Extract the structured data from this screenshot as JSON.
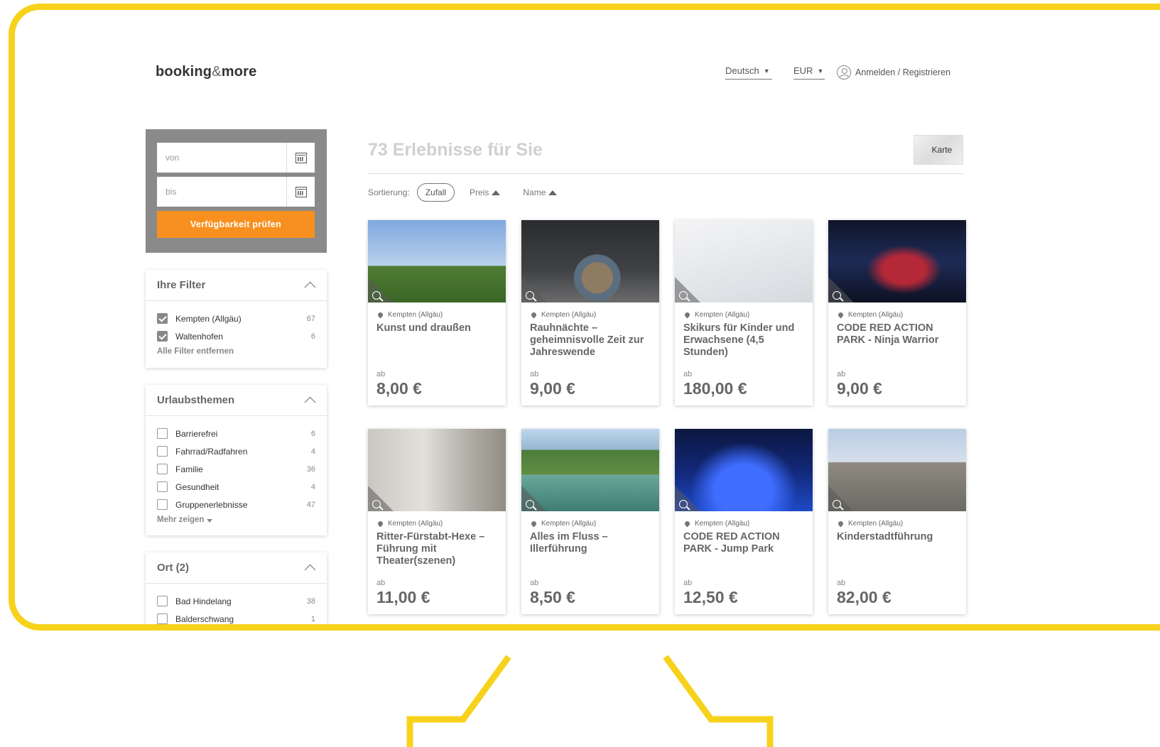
{
  "header": {
    "logo_main": "booking",
    "logo_amp": "&",
    "logo_end": "more",
    "language": "Deutsch",
    "currency": "EUR",
    "login": "Anmelden / Registrieren"
  },
  "availability": {
    "from_placeholder": "von",
    "to_placeholder": "bis",
    "check_button": "Verfügbarkeit prüfen"
  },
  "filters": {
    "active": {
      "title": "Ihre Filter",
      "items": [
        {
          "label": "Kempten (Allgäu)",
          "count": "67",
          "checked": true
        },
        {
          "label": "Waltenhofen",
          "count": "6",
          "checked": true
        }
      ],
      "remove_all": "Alle Filter entfernen"
    },
    "themes": {
      "title": "Urlaubsthemen",
      "items": [
        {
          "label": "Barrierefrei",
          "count": "6",
          "checked": false
        },
        {
          "label": "Fahrrad/Radfahren",
          "count": "4",
          "checked": false
        },
        {
          "label": "Familie",
          "count": "36",
          "checked": false
        },
        {
          "label": "Gesundheit",
          "count": "4",
          "checked": false
        },
        {
          "label": "Gruppenerlebnisse",
          "count": "47",
          "checked": false
        }
      ],
      "more": "Mehr zeigen"
    },
    "place": {
      "title": "Ort (2)",
      "items": [
        {
          "label": "Bad Hindelang",
          "count": "38",
          "checked": false
        },
        {
          "label": "Balderschwang",
          "count": "1",
          "checked": false
        }
      ]
    }
  },
  "results": {
    "title": "73 Erlebnisse für Sie",
    "map_button": "Karte",
    "sort_label": "Sortierung:",
    "sort_options": [
      "Zufall",
      "Preis",
      "Name"
    ],
    "active_sort": "Zufall",
    "price_prefix": "ab",
    "cards": [
      {
        "location": "Kempten (Allgäu)",
        "title": "Kunst und draußen",
        "price": "8,00 €",
        "image": "art-sky"
      },
      {
        "location": "Kempten (Allgäu)",
        "title": "Rauhnächte – geheimnisvolle Zeit zur Jahreswende",
        "price": "9,00 €",
        "image": "art-smoke"
      },
      {
        "location": "Kempten (Allgäu)",
        "title": "Skikurs für Kinder und Erwachsene (4,5 Stunden)",
        "price": "180,00 €",
        "image": "art-ski"
      },
      {
        "location": "Kempten (Allgäu)",
        "title": "CODE RED ACTION PARK - Ninja Warrior",
        "price": "9,00 €",
        "image": "art-red"
      },
      {
        "location": "Kempten (Allgäu)",
        "title": "Ritter-Fürstabt-Hexe – Führung mit Theater(szenen)",
        "price": "11,00 €",
        "image": "art-street"
      },
      {
        "location": "Kempten (Allgäu)",
        "title": "Alles im Fluss – Illerführung",
        "price": "8,50 €",
        "image": "art-river"
      },
      {
        "location": "Kempten (Allgäu)",
        "title": "CODE RED ACTION PARK - Jump Park",
        "price": "12,50 €",
        "image": "art-blue"
      },
      {
        "location": "Kempten (Allgäu)",
        "title": "Kinderstadtführung",
        "price": "82,00 €",
        "image": "art-family"
      }
    ]
  },
  "colors": {
    "frame": "#f7d21c",
    "accent": "#f7901e",
    "filter_box": "#8a8a8a"
  }
}
